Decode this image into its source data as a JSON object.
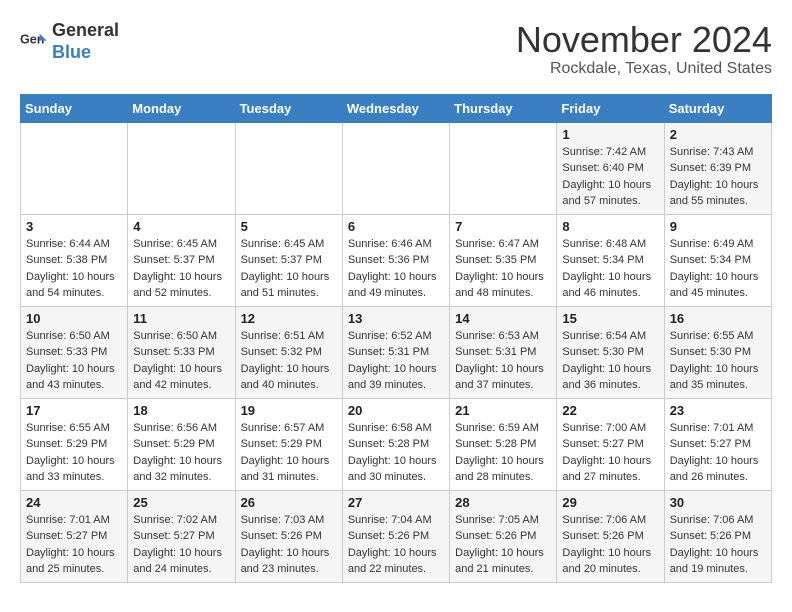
{
  "header": {
    "logo_general": "General",
    "logo_blue": "Blue",
    "title": "November 2024",
    "subtitle": "Rockdale, Texas, United States"
  },
  "weekdays": [
    "Sunday",
    "Monday",
    "Tuesday",
    "Wednesday",
    "Thursday",
    "Friday",
    "Saturday"
  ],
  "weeks": [
    [
      {
        "day": "",
        "info": ""
      },
      {
        "day": "",
        "info": ""
      },
      {
        "day": "",
        "info": ""
      },
      {
        "day": "",
        "info": ""
      },
      {
        "day": "",
        "info": ""
      },
      {
        "day": "1",
        "info": "Sunrise: 7:42 AM\nSunset: 6:40 PM\nDaylight: 10 hours\nand 57 minutes."
      },
      {
        "day": "2",
        "info": "Sunrise: 7:43 AM\nSunset: 6:39 PM\nDaylight: 10 hours\nand 55 minutes."
      }
    ],
    [
      {
        "day": "3",
        "info": "Sunrise: 6:44 AM\nSunset: 5:38 PM\nDaylight: 10 hours\nand 54 minutes."
      },
      {
        "day": "4",
        "info": "Sunrise: 6:45 AM\nSunset: 5:37 PM\nDaylight: 10 hours\nand 52 minutes."
      },
      {
        "day": "5",
        "info": "Sunrise: 6:45 AM\nSunset: 5:37 PM\nDaylight: 10 hours\nand 51 minutes."
      },
      {
        "day": "6",
        "info": "Sunrise: 6:46 AM\nSunset: 5:36 PM\nDaylight: 10 hours\nand 49 minutes."
      },
      {
        "day": "7",
        "info": "Sunrise: 6:47 AM\nSunset: 5:35 PM\nDaylight: 10 hours\nand 48 minutes."
      },
      {
        "day": "8",
        "info": "Sunrise: 6:48 AM\nSunset: 5:34 PM\nDaylight: 10 hours\nand 46 minutes."
      },
      {
        "day": "9",
        "info": "Sunrise: 6:49 AM\nSunset: 5:34 PM\nDaylight: 10 hours\nand 45 minutes."
      }
    ],
    [
      {
        "day": "10",
        "info": "Sunrise: 6:50 AM\nSunset: 5:33 PM\nDaylight: 10 hours\nand 43 minutes."
      },
      {
        "day": "11",
        "info": "Sunrise: 6:50 AM\nSunset: 5:33 PM\nDaylight: 10 hours\nand 42 minutes."
      },
      {
        "day": "12",
        "info": "Sunrise: 6:51 AM\nSunset: 5:32 PM\nDaylight: 10 hours\nand 40 minutes."
      },
      {
        "day": "13",
        "info": "Sunrise: 6:52 AM\nSunset: 5:31 PM\nDaylight: 10 hours\nand 39 minutes."
      },
      {
        "day": "14",
        "info": "Sunrise: 6:53 AM\nSunset: 5:31 PM\nDaylight: 10 hours\nand 37 minutes."
      },
      {
        "day": "15",
        "info": "Sunrise: 6:54 AM\nSunset: 5:30 PM\nDaylight: 10 hours\nand 36 minutes."
      },
      {
        "day": "16",
        "info": "Sunrise: 6:55 AM\nSunset: 5:30 PM\nDaylight: 10 hours\nand 35 minutes."
      }
    ],
    [
      {
        "day": "17",
        "info": "Sunrise: 6:55 AM\nSunset: 5:29 PM\nDaylight: 10 hours\nand 33 minutes."
      },
      {
        "day": "18",
        "info": "Sunrise: 6:56 AM\nSunset: 5:29 PM\nDaylight: 10 hours\nand 32 minutes."
      },
      {
        "day": "19",
        "info": "Sunrise: 6:57 AM\nSunset: 5:29 PM\nDaylight: 10 hours\nand 31 minutes."
      },
      {
        "day": "20",
        "info": "Sunrise: 6:58 AM\nSunset: 5:28 PM\nDaylight: 10 hours\nand 30 minutes."
      },
      {
        "day": "21",
        "info": "Sunrise: 6:59 AM\nSunset: 5:28 PM\nDaylight: 10 hours\nand 28 minutes."
      },
      {
        "day": "22",
        "info": "Sunrise: 7:00 AM\nSunset: 5:27 PM\nDaylight: 10 hours\nand 27 minutes."
      },
      {
        "day": "23",
        "info": "Sunrise: 7:01 AM\nSunset: 5:27 PM\nDaylight: 10 hours\nand 26 minutes."
      }
    ],
    [
      {
        "day": "24",
        "info": "Sunrise: 7:01 AM\nSunset: 5:27 PM\nDaylight: 10 hours\nand 25 minutes."
      },
      {
        "day": "25",
        "info": "Sunrise: 7:02 AM\nSunset: 5:27 PM\nDaylight: 10 hours\nand 24 minutes."
      },
      {
        "day": "26",
        "info": "Sunrise: 7:03 AM\nSunset: 5:26 PM\nDaylight: 10 hours\nand 23 minutes."
      },
      {
        "day": "27",
        "info": "Sunrise: 7:04 AM\nSunset: 5:26 PM\nDaylight: 10 hours\nand 22 minutes."
      },
      {
        "day": "28",
        "info": "Sunrise: 7:05 AM\nSunset: 5:26 PM\nDaylight: 10 hours\nand 21 minutes."
      },
      {
        "day": "29",
        "info": "Sunrise: 7:06 AM\nSunset: 5:26 PM\nDaylight: 10 hours\nand 20 minutes."
      },
      {
        "day": "30",
        "info": "Sunrise: 7:06 AM\nSunset: 5:26 PM\nDaylight: 10 hours\nand 19 minutes."
      }
    ]
  ]
}
